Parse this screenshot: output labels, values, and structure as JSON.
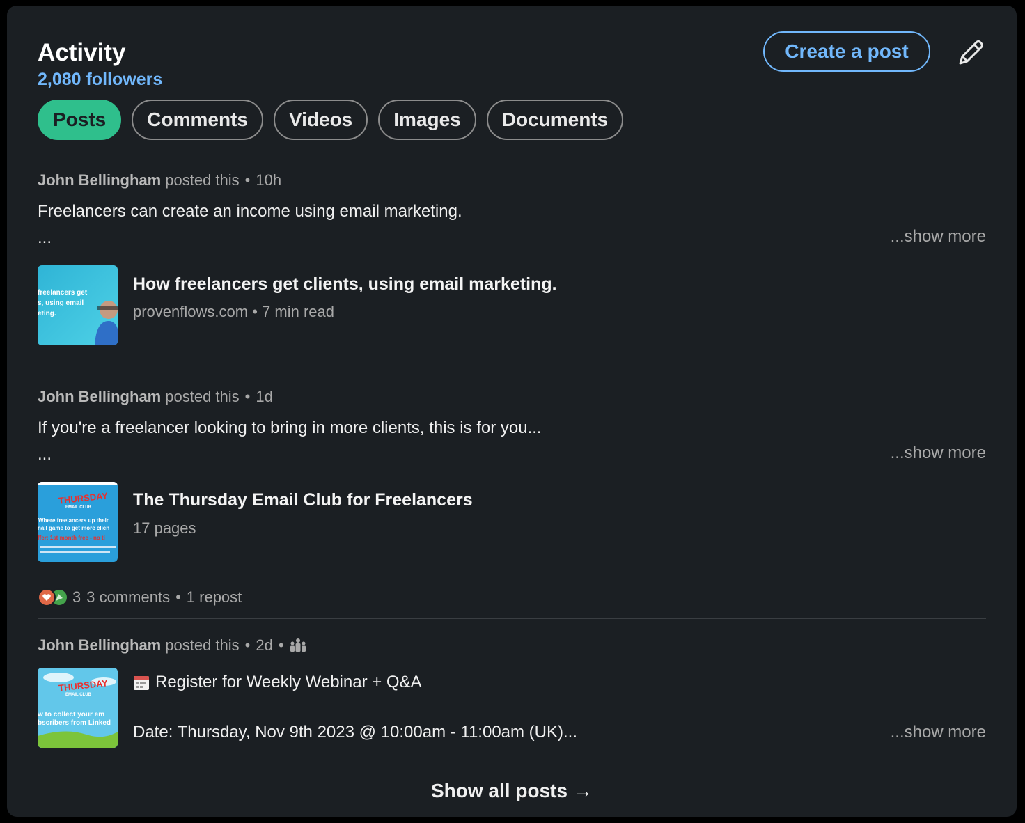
{
  "header": {
    "title": "Activity",
    "followers": "2,080 followers",
    "create_post": "Create a post"
  },
  "filters": [
    {
      "label": "Posts",
      "active": true
    },
    {
      "label": "Comments",
      "active": false
    },
    {
      "label": "Videos",
      "active": false
    },
    {
      "label": "Images",
      "active": false
    },
    {
      "label": "Documents",
      "active": false
    }
  ],
  "posts": [
    {
      "author": "John Bellingham",
      "action": "posted this",
      "time": "10h",
      "text": "Freelancers can create an income using email marketing.",
      "ellipsis": "...",
      "show_more": "...show more",
      "link_title": "How freelancers get clients, using email marketing.",
      "link_source": "provenflows.com",
      "link_readtime": "7 min read",
      "thumb_lines": [
        "freelancers get",
        "s, using email",
        "eting."
      ]
    },
    {
      "author": "John Bellingham",
      "action": "posted this",
      "time": "1d",
      "text": "If you're a freelancer looking to bring in more clients, this is for you...",
      "ellipsis": "...",
      "show_more": "...show more",
      "link_title": "The Thursday Email Club for Freelancers",
      "link_sub": "17 pages",
      "thumb_logo": "THURSDAY",
      "thumb_logo_sub": "EMAIL CLUB",
      "thumb_lines": [
        "Where freelancers up their",
        "nail game to get more clien"
      ],
      "thumb_offer": "ffer: 1st month free - no ti",
      "reaction_count": "3",
      "comments": "3 comments",
      "reposts": "1 repost",
      "colors": {
        "heart": "#e06847",
        "celebrate": "#44a34b"
      }
    },
    {
      "author": "John Bellingham",
      "action": "posted this",
      "time": "2d",
      "visibility_icon": "group-icon",
      "line1": "Register for Weekly Webinar + Q&A",
      "calendar_icon": "calendar-icon",
      "line2": "Date: Thursday, Nov 9th 2023 @ 10:00am - 11:00am (UK)...",
      "show_more": "...show more",
      "thumb_logo": "THURSDAY",
      "thumb_logo_sub": "EMAIL CLUB",
      "thumb_lines": [
        "w to collect your em",
        "bscribers from Linked"
      ]
    }
  ],
  "footer": {
    "show_all": "Show all posts",
    "arrow": "→"
  },
  "colors": {
    "background": "#1b1f23",
    "accent": "#71b7fb",
    "active_pill": "#2fbf8c"
  }
}
